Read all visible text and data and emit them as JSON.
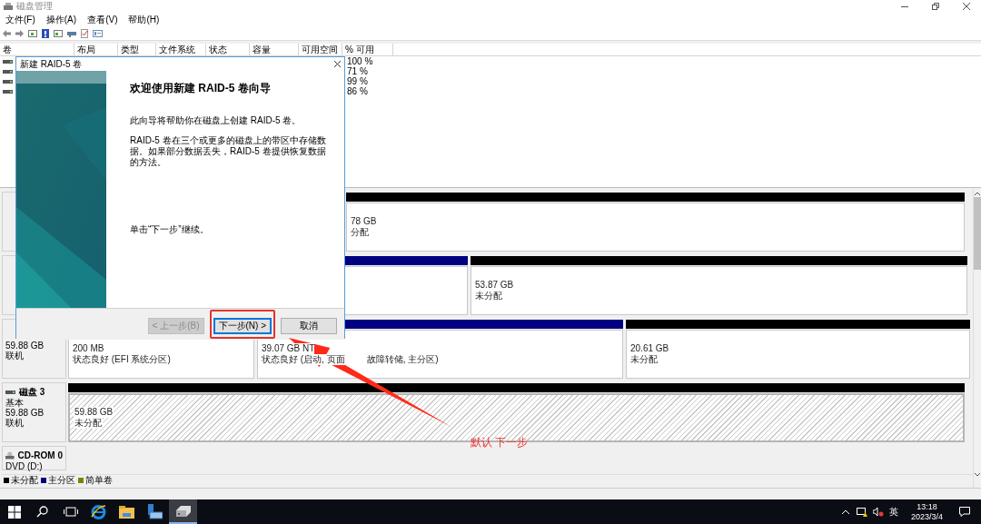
{
  "window": {
    "title": "磁盘管理"
  },
  "menu": [
    "文件(F)",
    "操作(A)",
    "查看(V)",
    "帮助(H)"
  ],
  "volume_table": {
    "columns": [
      "卷",
      "布局",
      "类型",
      "文件系统",
      "状态",
      "容量",
      "可用空间",
      "% 可用"
    ],
    "rows": [
      {
        "percent_free": "100 %"
      },
      {
        "percent_free": "71 %"
      },
      {
        "percent_free": "99 %"
      },
      {
        "percent_free": "86 %"
      }
    ]
  },
  "disks": [
    {
      "kind": "disk",
      "partitions": [
        {
          "kind": "unallocated",
          "selected": false,
          "lines": [
            "78 GB",
            "分配"
          ]
        }
      ]
    },
    {
      "kind": "disk",
      "partitions": [
        {
          "kind": "primary",
          "selected": false
        },
        {
          "kind": "unallocated",
          "selected": false,
          "lines": [
            "53.87 GB",
            "未分配"
          ]
        }
      ]
    },
    {
      "kind": "disk",
      "lines": [
        "59.88 GB",
        "联机"
      ],
      "partitions": [
        {
          "kind": "primary",
          "selected": false,
          "lines": [
            "200 MB",
            "状态良好 (EFI 系统分区)"
          ]
        },
        {
          "kind": "primary",
          "selected": false,
          "lines": [
            "39.07 GB NT",
            "状态良好 (启动, 页面",
            "故障转储, 主分区)"
          ]
        },
        {
          "kind": "unallocated",
          "selected": false,
          "lines": [
            "20.61 GB",
            "未分配"
          ]
        }
      ]
    },
    {
      "kind": "disk",
      "name": "磁盘 3",
      "lines": [
        "基本",
        "59.88 GB",
        "联机"
      ],
      "partitions": [
        {
          "kind": "unallocated",
          "selected": true,
          "lines": [
            "59.88 GB",
            "未分配"
          ]
        }
      ]
    },
    {
      "kind": "cdrom",
      "name": "CD-ROM 0",
      "lines": [
        "DVD (D:)"
      ]
    }
  ],
  "legend": [
    {
      "label": "未分配",
      "color": "#000000"
    },
    {
      "label": "主分区",
      "color": "#000080"
    },
    {
      "label": "简单卷",
      "color": "#808000"
    }
  ],
  "dialog": {
    "title": "新建 RAID-5 卷",
    "heading": "欢迎使用新建 RAID-5 卷向导",
    "paragraphs": [
      "此向导将帮助你在磁盘上创建 RAID-5 卷。",
      "RAID-5 卷在三个或更多的磁盘上的带区中存储数据。如果部分数据丢失，RAID-5 卷提供恢复数据的方法。"
    ],
    "continue_hint": "单击“下一步”继续。",
    "buttons": [
      {
        "label": "< 上一步(B)",
        "disabled": true,
        "highlighted": false
      },
      {
        "label": "下一步(N) >",
        "disabled": false,
        "highlighted": true
      },
      {
        "label": "取消",
        "disabled": false,
        "highlighted": false
      }
    ]
  },
  "annotation": {
    "text": "默认 下一步"
  },
  "taskbar": {
    "apps": [
      {
        "kind": "start",
        "active": false
      },
      {
        "kind": "search",
        "active": false
      },
      {
        "kind": "taskview",
        "active": false
      },
      {
        "kind": "browser",
        "active": false
      },
      {
        "kind": "folder",
        "active": false
      },
      {
        "kind": "server",
        "active": false
      },
      {
        "kind": "disk",
        "active": true
      }
    ],
    "language": "英",
    "time": "13:18",
    "date": "2023/3/4"
  }
}
